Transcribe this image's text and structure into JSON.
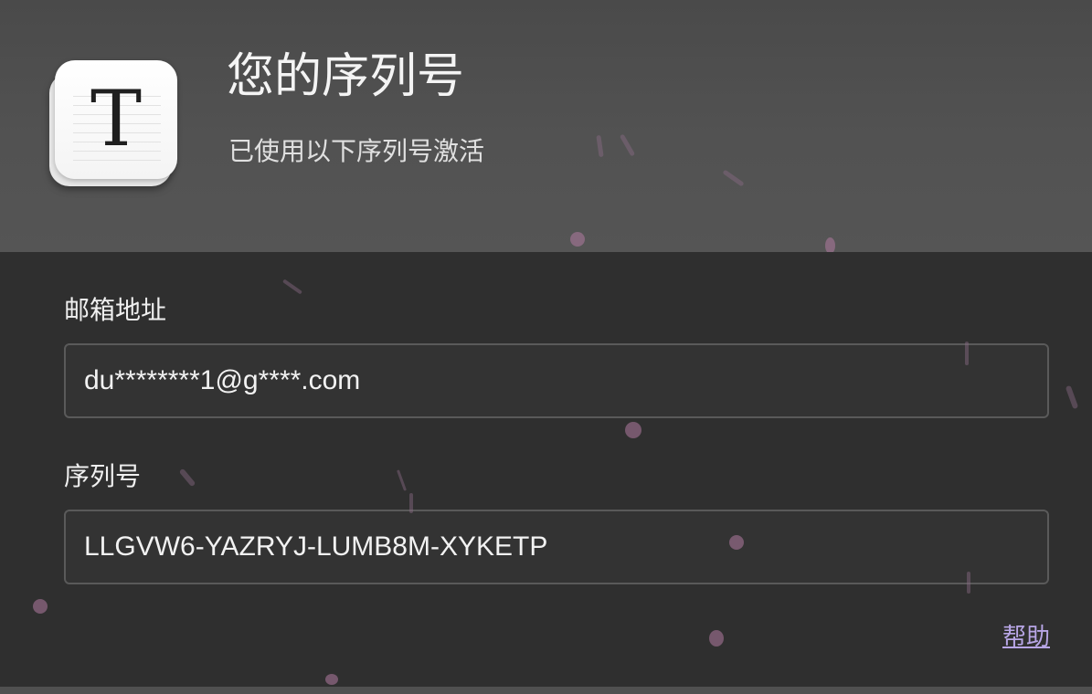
{
  "header": {
    "app_icon_letter": "T",
    "title": "您的序列号",
    "subtitle": "已使用以下序列号激活"
  },
  "form": {
    "email": {
      "label": "邮箱地址",
      "value": "du********1@g****.com"
    },
    "serial": {
      "label": "序列号",
      "value": "LLGVW6-YAZRYJ-LUMB8M-XYKETP"
    },
    "help_label": "帮助"
  },
  "colors": {
    "header_bg": "#555555",
    "form_bg": "#2f2f2f",
    "link": "#b8a6e6",
    "petal": "#b07aa0"
  }
}
